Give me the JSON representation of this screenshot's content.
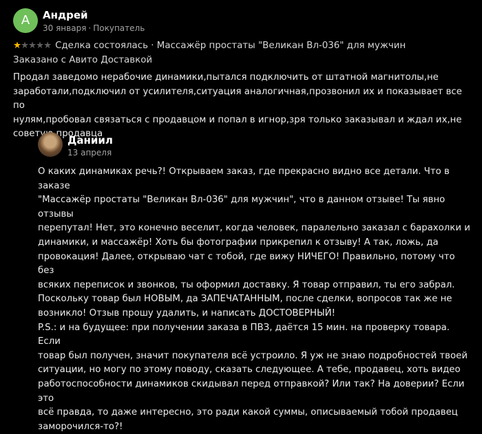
{
  "review": {
    "avatar_letter": "А",
    "author": "Андрей",
    "date": "30 января",
    "separator": "·",
    "role": "Покупатель",
    "rating": 1,
    "deal_text": "Сделка состоялась · Массажёр простаты \"Великан Вл-036\" для мужчин",
    "delivery": "Заказано с Авито Доставкой",
    "text": "Продал заведомо нерабочие динамики,пытался подключить от штатной магнитолы,не\nзаработали,подключил от усилителя,ситуация аналогичная,прозвонил их и показывает все по\nнулям,пробовал связаться с продавцом и попал в игнор,зря только заказывал и ждал их,не\nсоветую продавца"
  },
  "reply": {
    "author": "Даниил",
    "date": "13 апреля",
    "text": "О каких динамиках речь?! Открываем заказ, где прекрасно видно все детали. Что в заказе\n\"Массажёр простаты \"Великан Вл-036\" для мужчин\", что в данном отзыве! Ты явно отзывы\nперепутал! Нет, это конечно веселит, когда человек, паралельно заказал с барахолки и\nдинамики, и массажёр! Хоть бы фотографии прикрепил к отзыву! А так, ложь, да\nпровокация! Далее, открываю чат с тобой, где вижу НИЧЕГО! Правильно, потому что без\nвсяких переписок и звонков, ты оформил доставку. Я товар отправил, ты его забрал.\nПоскольку товар был НОВЫМ, да ЗАПЕЧАТАННЫМ, после сделки, вопросов так же не\nвозникло! Отзыв прошу удалить, и написать ДОСТОВЕРНЫЙ!\nP.S.: и на будущее: при получении заказа в ПВЗ, даётся 15 мин. на проверку товара. Если\nтовар был получен, значит покупателя всё устроило. Я уж не знаю подробностей твоей\nситуации, но могу по этому поводу, сказать следующее. А тебе, продавец, хоть видео\nработоспособности динамиков скидывал перед отправкой? Или так? На доверии? Если это\nвсё правда, то даже интересно, это ради какой суммы, описываемый тобой продавец\nзаморочился-то?!"
  },
  "colors": {
    "background": "#000000",
    "avatar": "#6fbf5a",
    "star_on": "#ffb800",
    "star_off": "#5d5d5d",
    "muted": "#a3a3a3"
  }
}
